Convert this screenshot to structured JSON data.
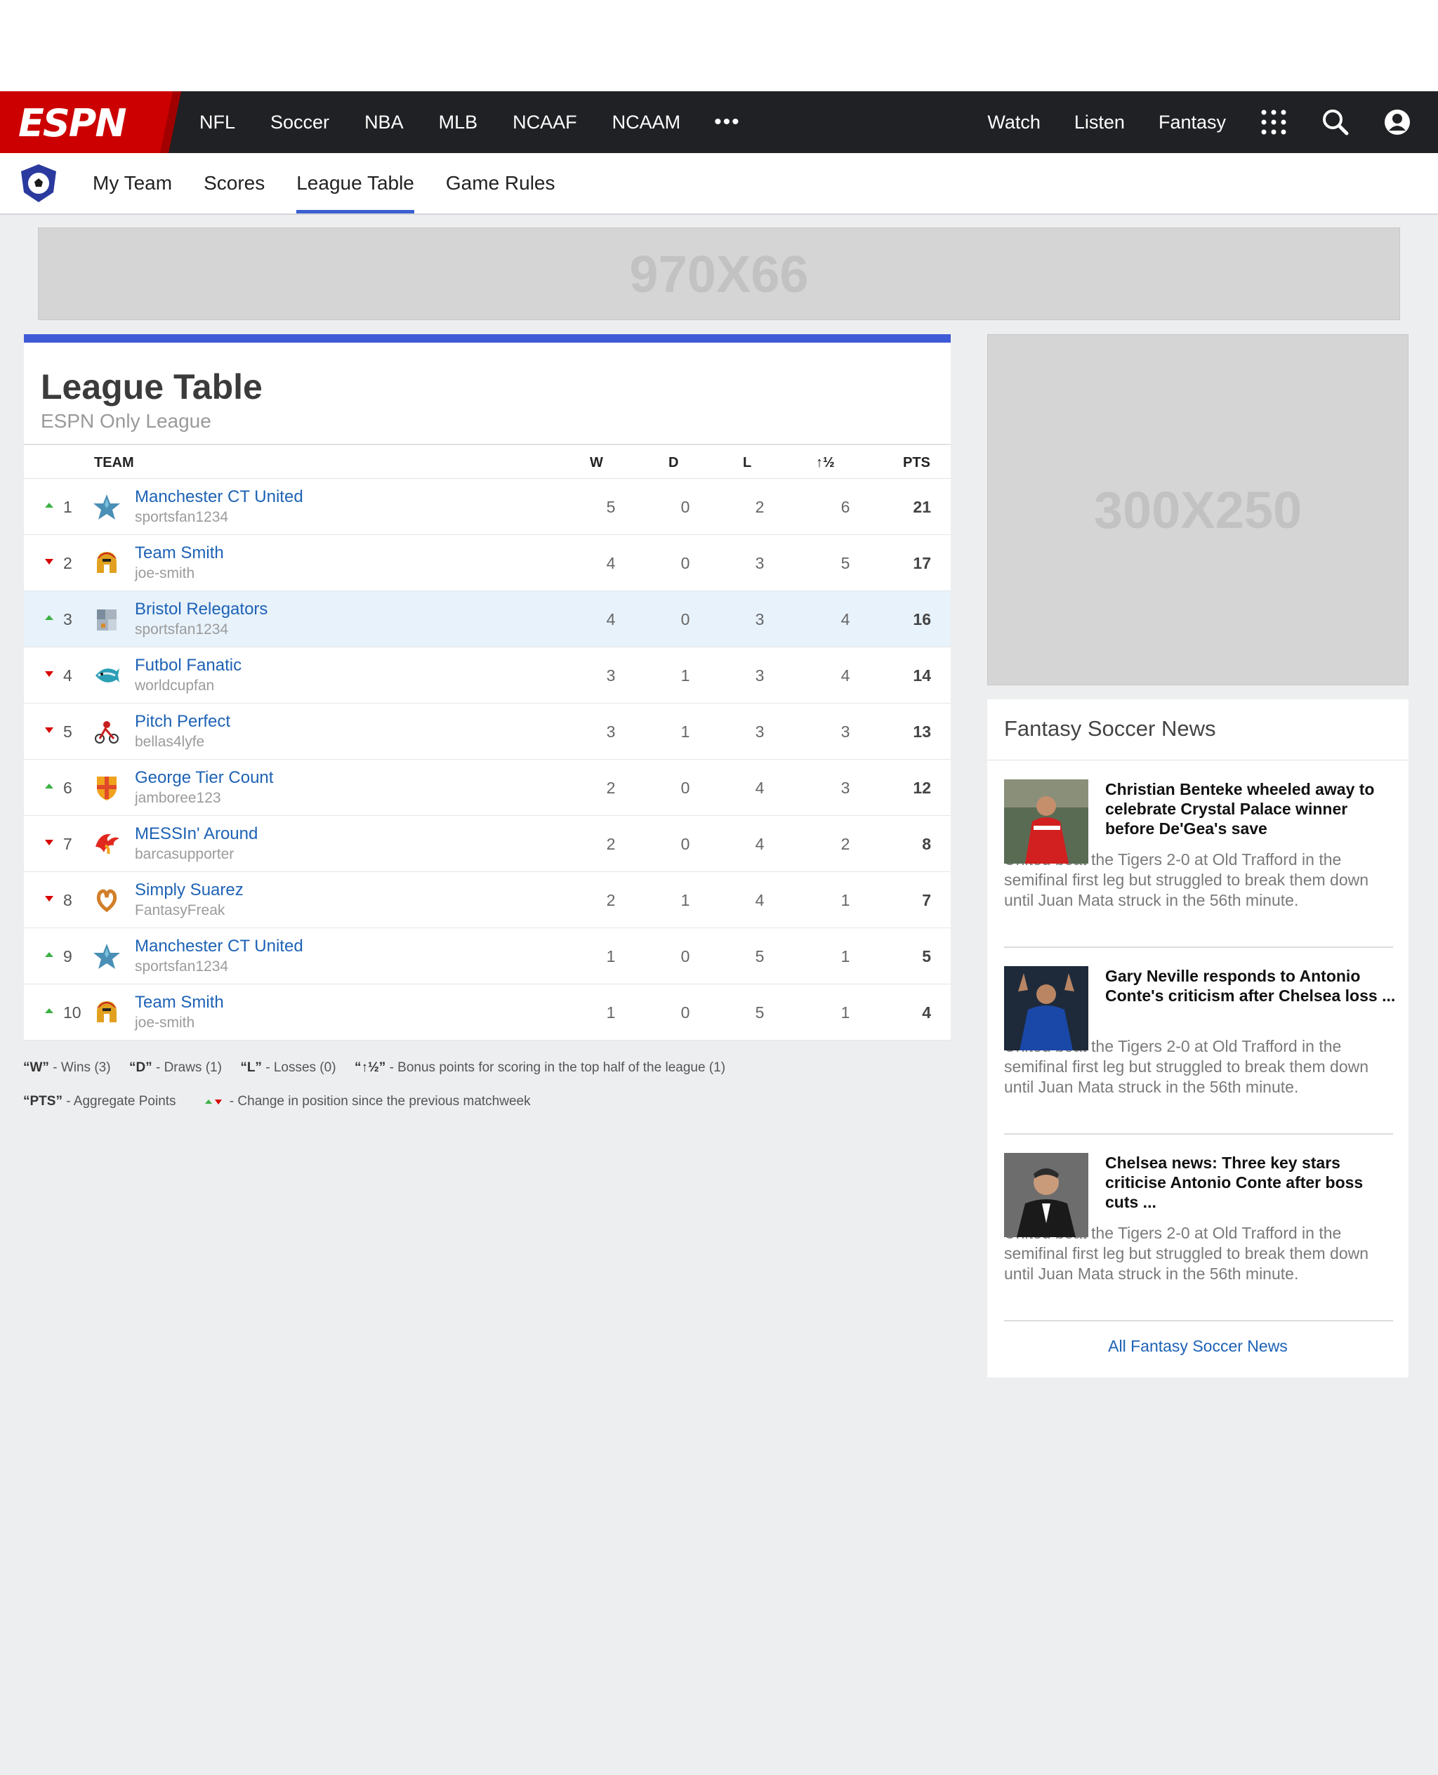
{
  "nav": {
    "logo": "ESPN",
    "links": [
      "NFL",
      "Soccer",
      "NBA",
      "MLB",
      "NCAAF",
      "NCAAM"
    ],
    "more": "•••",
    "right_links": [
      "Watch",
      "Listen",
      "Fantasy"
    ],
    "icons": [
      "apps-grid-icon",
      "search-icon",
      "user-icon"
    ]
  },
  "subnav": {
    "tabs": [
      "My Team",
      "Scores",
      "League Table",
      "Game Rules"
    ],
    "active_tab": "League Table",
    "accent": "#3b5fd0"
  },
  "ads": {
    "top": "970X66",
    "side": "300X250"
  },
  "league": {
    "title": "League Table",
    "subtitle": "ESPN Only League",
    "columns": [
      "TEAM",
      "W",
      "D",
      "L",
      "↑½",
      "PTS"
    ],
    "rows": [
      {
        "change": "up",
        "rank": "1",
        "icon": "star-icon",
        "team": "Manchester CT United",
        "user": "sportsfan1234",
        "w": "5",
        "d": "0",
        "l": "2",
        "bonus": "6",
        "pts": "21"
      },
      {
        "change": "down",
        "rank": "2",
        "icon": "spartan-helmet-icon",
        "team": "Team Smith",
        "user": "joe-smith",
        "w": "4",
        "d": "0",
        "l": "3",
        "bonus": "5",
        "pts": "17"
      },
      {
        "change": "up",
        "rank": "3",
        "icon": "castle-icon",
        "team": "Bristol Relegators",
        "user": "sportsfan1234",
        "w": "4",
        "d": "0",
        "l": "3",
        "bonus": "4",
        "pts": "16",
        "highlight": true
      },
      {
        "change": "down",
        "rank": "4",
        "icon": "fish-icon",
        "team": "Futbol Fanatic",
        "user": "worldcupfan",
        "w": "3",
        "d": "1",
        "l": "3",
        "bonus": "4",
        "pts": "14"
      },
      {
        "change": "down",
        "rank": "5",
        "icon": "racing-mascot-icon",
        "team": "Pitch Perfect",
        "user": "bellas4lyfe",
        "w": "3",
        "d": "1",
        "l": "3",
        "bonus": "3",
        "pts": "13"
      },
      {
        "change": "up",
        "rank": "6",
        "icon": "shield-crest-icon",
        "team": "George Tier Count",
        "user": "jamboree123",
        "w": "2",
        "d": "0",
        "l": "4",
        "bonus": "3",
        "pts": "12"
      },
      {
        "change": "down",
        "rank": "7",
        "icon": "phoenix-icon",
        "team": "MESSIn' Around",
        "user": "barcasupporter",
        "w": "2",
        "d": "0",
        "l": "4",
        "bonus": "2",
        "pts": "8"
      },
      {
        "change": "down",
        "rank": "8",
        "icon": "pretzel-icon",
        "team": "Simply Suarez",
        "user": "FantasyFreak",
        "w": "2",
        "d": "1",
        "l": "4",
        "bonus": "1",
        "pts": "7"
      },
      {
        "change": "up",
        "rank": "9",
        "icon": "star-icon",
        "team": "Manchester CT United",
        "user": "sportsfan1234",
        "w": "1",
        "d": "0",
        "l": "5",
        "bonus": "1",
        "pts": "5"
      },
      {
        "change": "up",
        "rank": "10",
        "icon": "spartan-helmet-icon",
        "team": "Team Smith",
        "user": "joe-smith",
        "w": "1",
        "d": "0",
        "l": "5",
        "bonus": "1",
        "pts": "4"
      }
    ],
    "legend": {
      "w_key": "“W”",
      "w_text": " - Wins (3)",
      "d_key": "“D”",
      "d_text": " - Draws (1)",
      "l_key": "“L”",
      "l_text": " - Losses (0)",
      "b_key": "“↑½”",
      "b_text": " - Bonus points for scoring in the top half of the league (1)",
      "pts_key": "“PTS”",
      "pts_text": " - Aggregate Points",
      "change_text": " - Change in position since the previous matchweek"
    }
  },
  "news": {
    "heading": "Fantasy Soccer News",
    "articles": [
      {
        "title": "Christian Benteke wheeled away to celebrate Crystal Palace winner before De'Gea's save",
        "body": "United beat the Tigers 2-0 at Old Trafford in the semifinal first leg but struggled to break them down until Juan Mata struck in the 56th minute."
      },
      {
        "title": "Gary Neville responds to Antonio Conte's criticism after Chelsea loss ...",
        "body": "United beat the Tigers 2-0 at Old Trafford in the semifinal first leg but struggled to break them down until Juan Mata struck in the 56th minute."
      },
      {
        "title": "Chelsea news: Three key stars criticise Antonio Conte after boss cuts ...",
        "body": "United beat the Tigers 2-0 at Old Trafford in the semifinal first leg but struggled to break them down until Juan Mata struck in the 56th minute."
      }
    ],
    "all_link": "All Fantasy Soccer News"
  },
  "colors": {
    "espn_red": "#cc0000",
    "nav_bg": "#202124",
    "link": "#1d62b5",
    "table_accent": "#3f5ad6"
  }
}
